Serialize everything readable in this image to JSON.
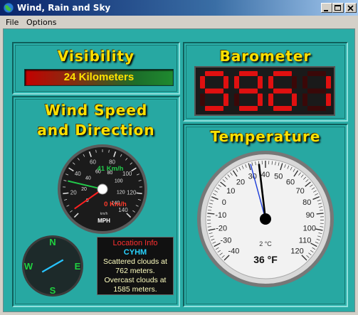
{
  "window": {
    "title": "Wind, Rain and Sky"
  },
  "menu": {
    "file": "File",
    "options": "Options"
  },
  "visibility": {
    "heading": "Visibility",
    "value": "24 Kilometers"
  },
  "barometer": {
    "heading": "Barometer",
    "display": "9961"
  },
  "wind": {
    "heading_line1": "Wind Speed",
    "heading_line2": "and Direction",
    "speed_kmh_label": "41 Km/h",
    "gust_kmh_label": "0 Km/h",
    "unit_small": "km/h",
    "unit_main": "MPH",
    "mph_ticks": [
      "0",
      "20",
      "40",
      "60",
      "80",
      "100",
      "120",
      "140"
    ],
    "kmh_ticks": [
      "20",
      "40",
      "60",
      "80",
      "100",
      "120",
      "140"
    ],
    "speed_mph": 26,
    "gust_mph": 0
  },
  "compass": {
    "n": "N",
    "s": "S",
    "e": "E",
    "w": "W",
    "direction_deg": 240
  },
  "location": {
    "title": "Location Info",
    "code": "CYHM",
    "description": "Scattered clouds at 762 meters. Overcast clouds at 1585 meters."
  },
  "temperature": {
    "heading": "Temperature",
    "value_label": "36 °F",
    "celsius_unit": "2 °C",
    "f_ticks": [
      "-40",
      "-30",
      "-20",
      "-10",
      "0",
      "10",
      "20",
      "30",
      "40",
      "50",
      "60",
      "70",
      "80",
      "90",
      "100",
      "110",
      "120"
    ],
    "current_f": 36,
    "marker_f": 31
  },
  "colors": {
    "accent": "#ffe100",
    "background": "#2aaca6",
    "led": "#e01010",
    "needle_green": "#22c94a"
  }
}
